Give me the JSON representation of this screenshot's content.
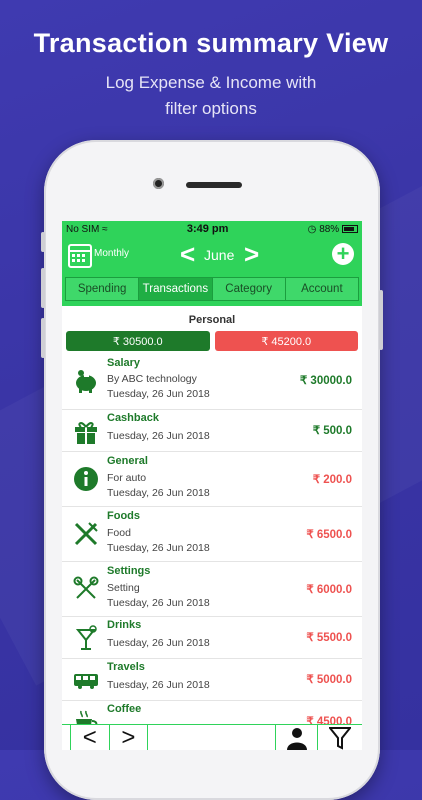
{
  "promo": {
    "headline": "Transaction summary View",
    "subline_1": "Log Expense & Income with",
    "subline_2": "filter options"
  },
  "status_bar": {
    "carrier": "No SIM",
    "time": "3:49 pm",
    "battery": "88%"
  },
  "header": {
    "period_label": "Monthly",
    "month": "June",
    "prev": "<",
    "next": ">",
    "add": "+"
  },
  "tabs": [
    "Spending",
    "Transactions",
    "Category",
    "Account"
  ],
  "active_tab": "Transactions",
  "section": "Personal",
  "totals": {
    "income": "₹ 30500.0",
    "expense": "₹ 45200.0"
  },
  "transactions": [
    {
      "name": "Salary",
      "note": "By ABC technology",
      "date": "Tuesday, 26 Jun 2018",
      "amount": "₹ 30000.0",
      "type": "income",
      "icon": "piggy-bank-icon"
    },
    {
      "name": "Cashback",
      "note": "",
      "date": "Tuesday, 26 Jun 2018",
      "amount": "₹ 500.0",
      "type": "income",
      "icon": "gift-icon"
    },
    {
      "name": "General",
      "note": "For auto",
      "date": "Tuesday, 26 Jun 2018",
      "amount": "₹ 200.0",
      "type": "expense",
      "icon": "info-icon"
    },
    {
      "name": "Foods",
      "note": "Food",
      "date": "Tuesday, 26 Jun 2018",
      "amount": "₹ 6500.0",
      "type": "expense",
      "icon": "fork-knife-icon"
    },
    {
      "name": "Settings",
      "note": "Setting",
      "date": "Tuesday, 26 Jun 2018",
      "amount": "₹ 6000.0",
      "type": "expense",
      "icon": "tools-icon"
    },
    {
      "name": "Drinks",
      "note": "",
      "date": "Tuesday, 26 Jun 2018",
      "amount": "₹ 5500.0",
      "type": "expense",
      "icon": "cocktail-icon"
    },
    {
      "name": "Travels",
      "note": "",
      "date": "Tuesday, 26 Jun 2018",
      "amount": "₹ 5000.0",
      "type": "expense",
      "icon": "bus-icon"
    },
    {
      "name": "Coffee",
      "note": "",
      "date": "",
      "amount": "₹ 4500.0",
      "type": "expense",
      "icon": "coffee-cup-icon"
    }
  ],
  "bottom_bar": {
    "prev": "<",
    "next": ">",
    "person_icon": "person-icon",
    "filter_icon": "filter-icon"
  },
  "colors": {
    "brand_green": "#2fd35a",
    "income_green": "#1e7a2a",
    "expense_red": "#ee5250",
    "background": "#3a35a6"
  }
}
